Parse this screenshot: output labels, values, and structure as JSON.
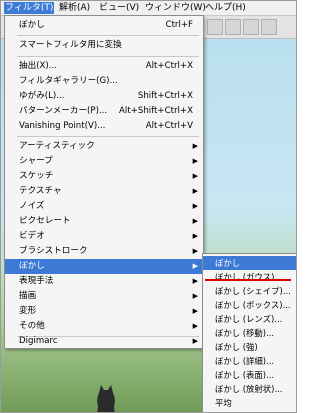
{
  "menubar": {
    "items": [
      "フィルタ(T)",
      "解析(A)",
      "ビュー(V)",
      "ウィンドウ(W)",
      "ヘルプ(H)"
    ]
  },
  "menu": {
    "top": {
      "label": "ぼかし",
      "shortcut": "Ctrl+F"
    },
    "convert": "スマートフィルタ用に変換",
    "group2": [
      {
        "label": "抽出(X)...",
        "shortcut": "Alt+Ctrl+X"
      },
      {
        "label": "フィルタギャラリー(G)...",
        "shortcut": ""
      },
      {
        "label": "ゆがみ(L)...",
        "shortcut": "Shift+Ctrl+X"
      },
      {
        "label": "パターンメーカー(P)...",
        "shortcut": "Alt+Shift+Ctrl+X"
      },
      {
        "label": "Vanishing Point(V)...",
        "shortcut": "Alt+Ctrl+V"
      }
    ],
    "group3": [
      "アーティスティック",
      "シャープ",
      "スケッチ",
      "テクスチャ",
      "ノイズ",
      "ピクセレート",
      "ビデオ",
      "ブラシストローク",
      "ぼかし",
      "表現手法",
      "描画",
      "変形",
      "その他"
    ],
    "highlighted": "ぼかし",
    "digimarc": "Digimarc"
  },
  "submenu": {
    "items": [
      "ぼかし",
      "ぼかし (ガウス)...",
      "ぼかし (シェイプ)...",
      "ぼかし (ボックス)...",
      "ぼかし (レンズ)...",
      "ぼかし (移動)...",
      "ぼかし (強)",
      "ぼかし (詳細)...",
      "ぼかし (表面)...",
      "ぼかし (放射状)...",
      "平均"
    ],
    "highlighted": "ぼかし",
    "emphasized": "ぼかし (ガウス)..."
  },
  "colors": {
    "highlight": "#3d7ad6",
    "underline": "#e00000",
    "menu_bg": "#f5f5f5"
  }
}
